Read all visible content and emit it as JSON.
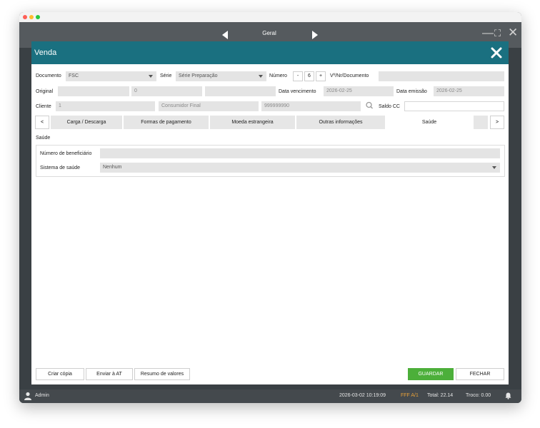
{
  "topbar": {
    "title": "Geral"
  },
  "modal": {
    "title": "Venda"
  },
  "form": {
    "documento": {
      "label": "Documento",
      "value": "FSC"
    },
    "serie": {
      "label": "Série",
      "value": "Série Preparação"
    },
    "numero": {
      "label": "Número",
      "minus": "-",
      "value": "6",
      "plus": "+"
    },
    "vnr": {
      "label": "Vº/Nr/Documento",
      "value": ""
    },
    "original": {
      "label": "Original",
      "value1": "",
      "value2": "0",
      "value3": ""
    },
    "data_vencimento": {
      "label": "Data vencimento",
      "value": "2026-02-25"
    },
    "data_emissao": {
      "label": "Data emissão",
      "value": "2026-02-25"
    },
    "cliente": {
      "label": "Cliente",
      "code": "1",
      "name": "Consumidor Final",
      "nif": "999999990"
    },
    "saldo_cc": {
      "label": "Saldo CC",
      "value": ""
    }
  },
  "tabs": {
    "prev": "<",
    "next": ">",
    "items": [
      {
        "label": "Carga / Descarga"
      },
      {
        "label": "Formas de pagamento"
      },
      {
        "label": "Moeda estrangeira"
      },
      {
        "label": "Outras informações"
      },
      {
        "label": "Saúde"
      }
    ],
    "active_index": 4
  },
  "saude": {
    "title": "Saúde",
    "numero_beneficiario": {
      "label": "Número de beneficiário",
      "value": ""
    },
    "sistema_saude": {
      "label": "Sistema de saúde",
      "value": "Nenhum"
    }
  },
  "footer": {
    "criar_copia": "Criar cópia",
    "enviar_at": "Enviar à AT",
    "resumo_valores": "Resumo de valores",
    "guardar": "GUARDAR",
    "fechar": "FECHAR"
  },
  "statusbar": {
    "user": "Admin",
    "datetime": "2026-03-02 10:19:09",
    "doc": "FFF A/1",
    "total": "Total:  22.14",
    "change": "Troco:  0.00"
  },
  "colors": {
    "header": "#1a7080",
    "primary_button": "#4caf3a",
    "status_doc": "#e8a13a"
  }
}
